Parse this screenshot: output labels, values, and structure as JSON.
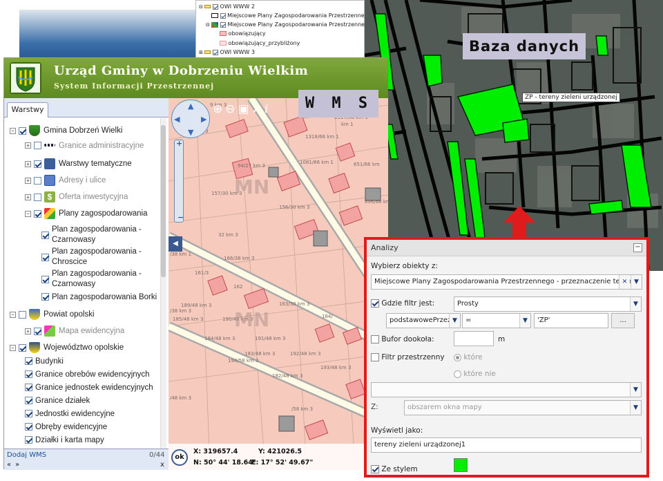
{
  "top_layers": {
    "rows": [
      {
        "label": "OWI WWW 2"
      },
      {
        "label": "Miejscowe Plany Zagospodarowania Przestrzennego -"
      },
      {
        "label": "Miejscowe Plany Zagospodarowania Przestrzennego -"
      },
      {
        "label": "obowiązujący"
      },
      {
        "label": "obowiązujący_przybliżony"
      },
      {
        "label": "OWI WWW 3"
      }
    ]
  },
  "header": {
    "title": "Urząd Gminy w Dobrzeniu Wielkim",
    "subtitle": "System Informacji Przestrzennej"
  },
  "tab": {
    "label": "Warstwy"
  },
  "tree": {
    "items": [
      {
        "label": "Gmina Dobrzeń Wielki",
        "icon": "coat-of-arms-icon"
      },
      {
        "label": "Granice administracyjne",
        "icon": "border-line-icon"
      },
      {
        "label": "Warstwy tematyczne",
        "icon": "layers-icon"
      },
      {
        "label": "Adresy i ulice",
        "icon": "envelope-icon"
      },
      {
        "label": "Oferta inwestycyjna",
        "icon": "dollar-icon"
      },
      {
        "label": "Plany zagospodarowania",
        "icon": "map-icon"
      },
      {
        "label": "Plan zagospodarowania - Czarnowasy"
      },
      {
        "label": "Plan zagospodarowania - Chroscice"
      },
      {
        "label": "Plan zagospodarowania - Czarnowasy"
      },
      {
        "label": "Plan zagospodarowania Borki"
      },
      {
        "label": "Powiat opolski",
        "icon": "coat-of-arms-icon"
      },
      {
        "label": "Mapa ewidencyjna",
        "icon": "cadastral-map-icon"
      },
      {
        "label": "Województwo opolskie",
        "icon": "eagle-icon"
      },
      {
        "label": "Budynki"
      },
      {
        "label": "Granice obrebów ewidencyjnych"
      },
      {
        "label": "Granice jednostek ewidencyjnych"
      },
      {
        "label": "Granice działek"
      },
      {
        "label": "Jednostki ewidencyjne"
      },
      {
        "label": "Obręby ewidencyjne"
      },
      {
        "label": "Działki i karta mapy"
      }
    ],
    "footer_link": "Dodaj WMS",
    "counter": "0/44",
    "nav_prev": "«",
    "nav_next": "»",
    "close": "x"
  },
  "map": {
    "labels": [
      "1317/66 km 1",
      "1318/66 km 1",
      "1081/66 km 1",
      "651/66 km",
      "94/27 km 3",
      "157/30 km 3",
      "156/30 km 3",
      "32 km 3",
      "166/38 km 3",
      "161/3",
      "162",
      "163/38 km 3",
      "189/48 km 3",
      "190/48 km 3",
      "185/48 km 3",
      "184/48 km 3",
      "191/48 km 3",
      "183/48 km 3",
      "194/58 km 3",
      "192/48 km 3",
      "193/48 km 3",
      "182/48 km 3",
      "164/",
      "696/66 km",
      "MN",
      "MN",
      "MN",
      "/38 km 1",
      "km 1",
      "km 3",
      "9 km 3",
      "/38 km 3",
      "/48 km 3",
      "/58 km 3"
    ],
    "coords": {
      "x": "X: 319657.4",
      "y": "Y: 421026.5",
      "n": "N: 50° 44' 18.64\"",
      "e": "E: 17° 52' 49.67\""
    },
    "ok": "ok"
  },
  "callouts": {
    "wms": "W M S",
    "baza": "Baza danych",
    "zp": "ZP - tereny zieleni urządzonej"
  },
  "analizy": {
    "title": "Analizy",
    "wybierz_label": "Wybierz obiekty z:",
    "wybierz_value": "Miejscowe Plany Zagospodarowania Przestrzennego - przeznaczenie terenów",
    "filtr_label": "Gdzie filtr jest:",
    "filtr_value": "Prosty",
    "field_value": "podstawowePrzez",
    "operator": "=",
    "compare_value": "'ZP'",
    "more_button": "...",
    "bufor_label": "Bufor dookoła:",
    "bufor_unit": "m",
    "filtr_przestrzenny_label": "Filtr przestrzenny",
    "ktore": "które",
    "ktore_nie": "które nie",
    "z_label": "Z:",
    "z_value": "obszarem okna mapy",
    "wyswietl_label": "Wyświetl jako:",
    "wyswietl_value": "tereny zieleni urządzonej1",
    "ze_stylem": "Ze stylem",
    "style_color": "#00ee00"
  },
  "colors": {
    "alert_border": "#e01b1b",
    "header_green": "#6a9a2a",
    "highlight_green": "#00ee00",
    "map_pink": "#f7c9bc"
  }
}
